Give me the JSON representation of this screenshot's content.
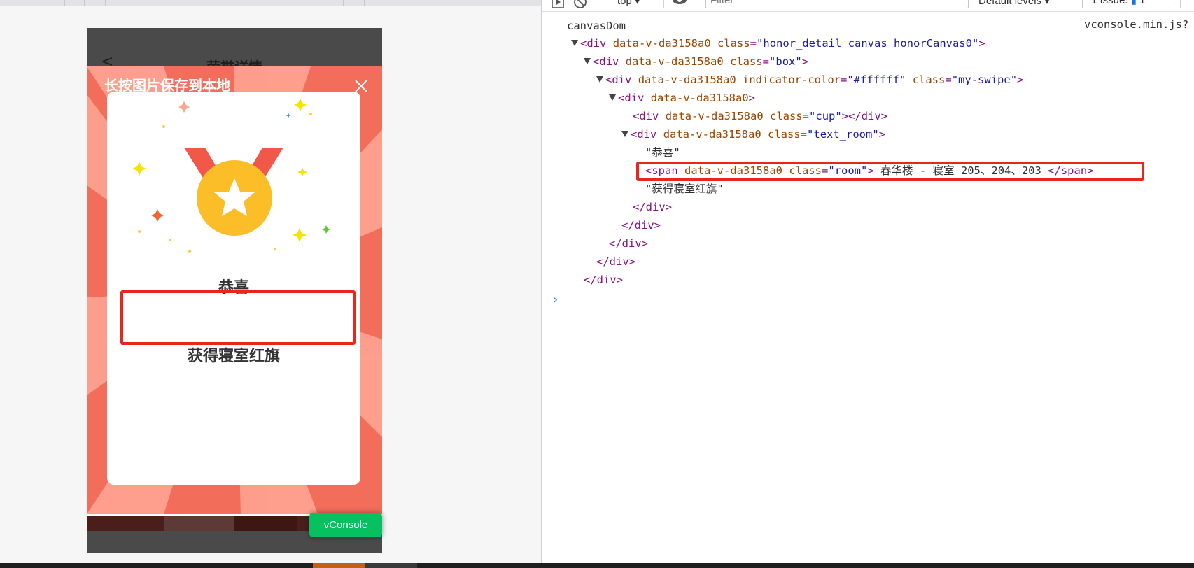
{
  "left": {
    "nav_title": "荣誉详情",
    "back_glyph": "<",
    "poster": {
      "hint": "长按图片保存到本地",
      "close_icon": "close-icon",
      "congrats": "恭喜",
      "room": "春华楼 - 寝室 205、204、203",
      "award": "获得寝室红旗"
    },
    "vconsole_label": "vConsole"
  },
  "devtools": {
    "toolbar": {
      "context": "top",
      "filter_placeholder": "Filter",
      "levels": "Default levels",
      "issues": "1 Issue:",
      "issues_count": "1"
    },
    "source_link": "vconsole.min.js?",
    "log_label": "canvasDom",
    "dom": [
      {
        "tag": "div",
        "attr": "data-v-da3158a0",
        "cls": "honor_detail canvas honorCanvas0"
      },
      {
        "tag": "div",
        "attr": "data-v-da3158a0",
        "cls": "box"
      },
      {
        "tag": "div",
        "attr": "data-v-da3158a0",
        "extra_name": "indicator-color",
        "extra_val": "#ffffff",
        "cls": "my-swipe"
      },
      {
        "tag": "div",
        "attr": "data-v-da3158a0"
      },
      {
        "tag": "div",
        "attr": "data-v-da3158a0",
        "cls": "cup"
      },
      {
        "tag": "div",
        "attr": "data-v-da3158a0",
        "cls": "text_room"
      },
      {
        "text": "\"恭喜\""
      },
      {
        "tag": "span",
        "attr": "data-v-da3158a0",
        "cls": "room",
        "inner": " 春华楼 - 寝室 205、204、203 "
      },
      {
        "text": "\"获得寝室红旗\""
      }
    ],
    "prompt_glyph": "›"
  },
  "colors": {
    "accent_red": "#e8261c",
    "vconsole_green": "#07c160",
    "medal_gold": "#fbbd28",
    "ribbon_red": "#f1584a",
    "poster_bg": "#f26d5a"
  }
}
